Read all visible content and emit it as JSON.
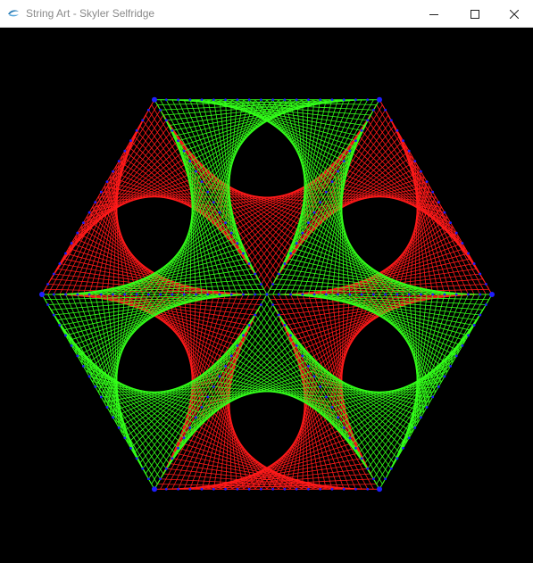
{
  "window": {
    "title": "String Art - Skyler Selfridge",
    "icon": "app-icon",
    "controls": {
      "minimize_icon": "minimize-icon",
      "maximize_icon": "maximize-icon",
      "close_icon": "close-icon"
    }
  },
  "art": {
    "shape": "hexagon",
    "background_color": "#000000",
    "colors": {
      "green": "#33ff1a",
      "red": "#ff1a1a",
      "nail": "#1f1fff"
    },
    "points_per_spoke": 38
  }
}
